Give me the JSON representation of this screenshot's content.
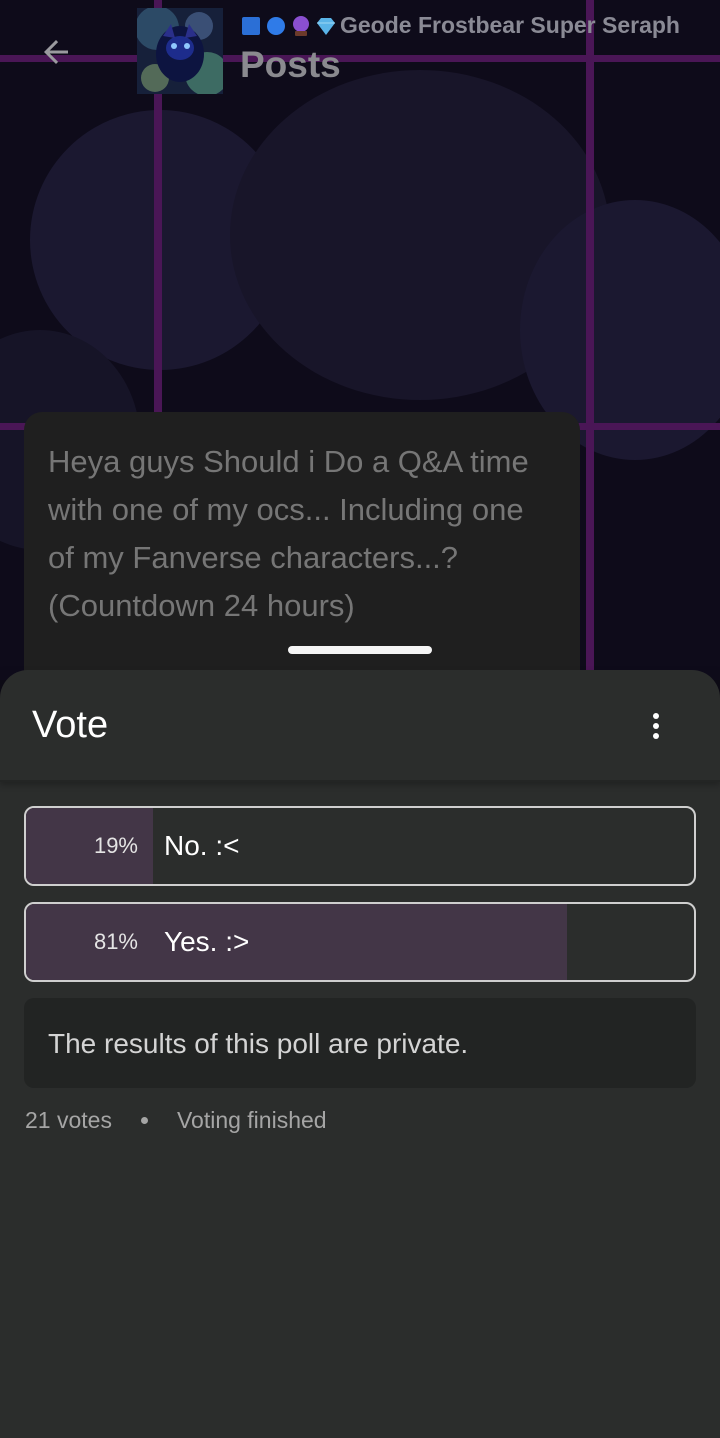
{
  "header": {
    "community_name": "Geode Frostbear Super Seraph",
    "title": "Posts",
    "emoji_icons": [
      "blue-square-icon",
      "blue-circle-icon",
      "crystal-ball-icon",
      "gem-icon"
    ]
  },
  "post": {
    "text": "Heya guys Should i Do a Q&A time with one of my ocs... Including one of my Fanverse characters...? (Countdown 24 hours)"
  },
  "sheet": {
    "title": "Vote",
    "options": [
      {
        "percent_label": "19%",
        "label": "No. :<",
        "fraction": 0.19
      },
      {
        "percent_label": "81%",
        "label": "Yes. :>",
        "fraction": 0.81
      }
    ],
    "private_note": "The results of this poll are private.",
    "votes": "21 votes",
    "status": "Voting finished"
  },
  "colors": {
    "sheet_bg": "#2b2d2c",
    "bar_fill": "#433647",
    "grid_accent": "#4a1656"
  }
}
